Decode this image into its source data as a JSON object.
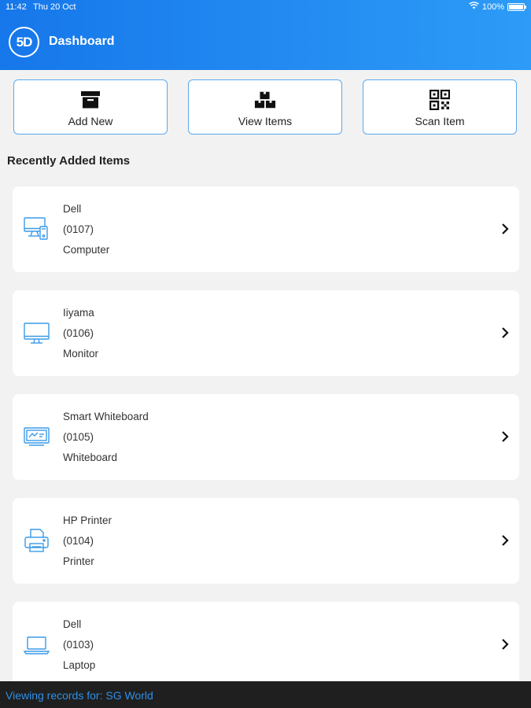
{
  "status_bar": {
    "time": "11:42",
    "date": "Thu 20 Oct",
    "battery": "100%"
  },
  "header": {
    "logo_text": "5D",
    "title": "Dashboard"
  },
  "actions": [
    {
      "label": "Add New",
      "icon": "archive-box-icon"
    },
    {
      "label": "View Items",
      "icon": "boxes-icon"
    },
    {
      "label": "Scan Item",
      "icon": "qr-code-icon"
    }
  ],
  "section_title": "Recently Added Items",
  "items": [
    {
      "name": "Dell",
      "code": "(0107)",
      "category": "Computer",
      "icon": "computer-icon"
    },
    {
      "name": "Iiyama",
      "code": "(0106)",
      "category": "Monitor",
      "icon": "monitor-icon"
    },
    {
      "name": "Smart Whiteboard",
      "code": "(0105)",
      "category": "Whiteboard",
      "icon": "whiteboard-icon"
    },
    {
      "name": "HP Printer",
      "code": "(0104)",
      "category": "Printer",
      "icon": "printer-icon"
    },
    {
      "name": "Dell",
      "code": "(0103)",
      "category": "Laptop",
      "icon": "laptop-icon"
    }
  ],
  "footer": {
    "text": "Viewing records for: SG World"
  },
  "colors": {
    "accent": "#1677ea",
    "icon_blue": "#3a9be8",
    "footer_text": "#2f8fe8"
  }
}
